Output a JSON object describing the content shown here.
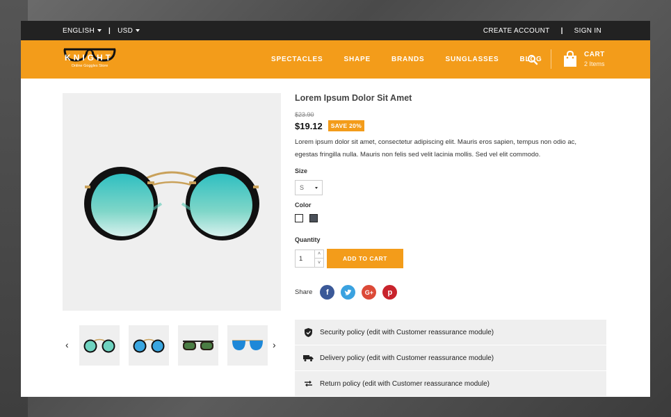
{
  "topbar": {
    "language": "ENGLISH",
    "currency": "USD",
    "separator": "|",
    "create_account": "CREATE ACCOUNT",
    "sign_in": "SIGN IN"
  },
  "header": {
    "logo_text": "KNIGHT",
    "logo_tagline": "Online Goggles Store",
    "nav": [
      "SPECTACLES",
      "SHAPE",
      "BRANDS",
      "SUNGLASSES",
      "BLOG"
    ],
    "cart_label": "CART",
    "cart_count": "2 Items"
  },
  "product": {
    "title": "Lorem Ipsum Dolor Sit Amet",
    "old_price": "$23.90",
    "price": "$19.12",
    "discount": "SAVE 20%",
    "description": "Lorem ipsum dolor sit amet, consectetur adipiscing elit. Mauris eros sapien, tempus non odio ac, egestas fringilla nulla. Mauris non felis sed velit lacinia mollis. Sed vel elit commodo.",
    "size_label": "Size",
    "size_value": "S",
    "color_label": "Color",
    "colors": [
      "#ffffff",
      "#4a5059"
    ],
    "quantity_label": "Quantity",
    "quantity_value": "1",
    "add_to_cart": "ADD TO CART",
    "share_label": "Share"
  },
  "policies": [
    "Security policy (edit with Customer reassurance module)",
    "Delivery policy (edit with Customer reassurance module)",
    "Return policy (edit with Customer reassurance module)"
  ],
  "colors": {
    "accent": "#f39c1a",
    "topbar": "#222222",
    "facebook": "#3b5998",
    "twitter": "#3aa2e0",
    "googleplus": "#dc4a38",
    "pinterest": "#c8232c"
  }
}
